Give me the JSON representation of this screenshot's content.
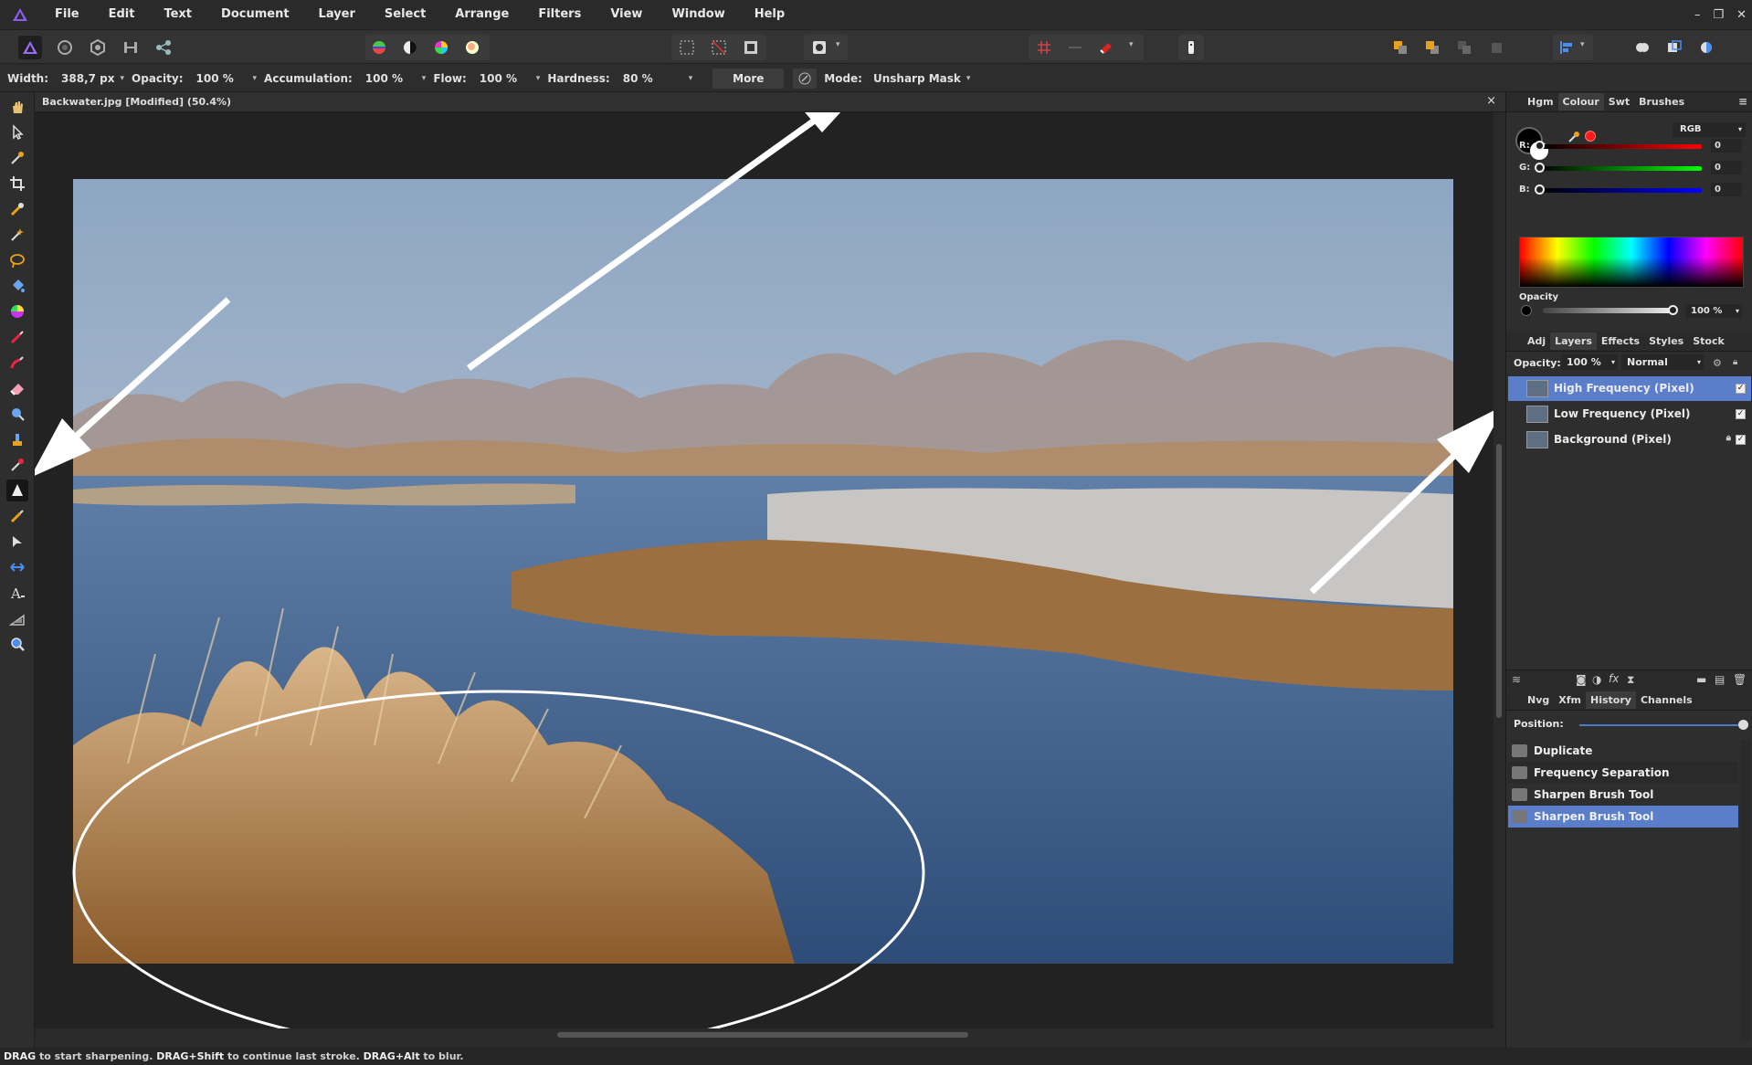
{
  "menubar": {
    "items": [
      "File",
      "Edit",
      "Text",
      "Document",
      "Layer",
      "Select",
      "Arrange",
      "Filters",
      "View",
      "Window",
      "Help"
    ],
    "window_controls": [
      "–",
      "❐",
      "✕"
    ]
  },
  "context": {
    "width_label": "Width:",
    "width_value": "388,7 px",
    "opacity_label": "Opacity:",
    "opacity_value": "100 %",
    "accumulation_label": "Accumulation:",
    "accumulation_value": "100 %",
    "flow_label": "Flow:",
    "flow_value": "100 %",
    "hardness_label": "Hardness:",
    "hardness_value": "80 %",
    "more_label": "More",
    "mode_label": "Mode:",
    "mode_value": "Unsharp Mask"
  },
  "document": {
    "title": "Backwater.jpg [Modified] (50.4%)",
    "close": "×"
  },
  "colour_panel": {
    "tabs": [
      "Hgm",
      "Colour",
      "Swt",
      "Brushes"
    ],
    "active_tab": "Colour",
    "model": "RGB",
    "r_label": "R:",
    "r_value": "0",
    "g_label": "G:",
    "g_value": "0",
    "b_label": "B:",
    "b_value": "0",
    "opacity_label": "Opacity",
    "opacity_value": "100 %",
    "primary_color": "#000000",
    "accent_red": "#ff1a1a"
  },
  "layers_panel": {
    "tabs": [
      "Adj",
      "Layers",
      "Effects",
      "Styles",
      "Stock"
    ],
    "active_tab": "Layers",
    "opacity_label": "Opacity:",
    "opacity_value": "100 %",
    "blend_mode": "Normal",
    "layers": [
      {
        "name": "High Frequency (Pixel)",
        "selected": true,
        "checked": "✓"
      },
      {
        "name": "Low Frequency (Pixel)",
        "selected": false,
        "checked": "✓"
      },
      {
        "name": "Background (Pixel)",
        "selected": false,
        "checked": "✓",
        "locked": true
      }
    ],
    "selection_color": "#5a7ec9"
  },
  "history_panel": {
    "tabs": [
      "Nvg",
      "Xfm",
      "History",
      "Channels"
    ],
    "active_tab": "History",
    "position_label": "Position:",
    "items": [
      {
        "name": "Duplicate",
        "selected": false
      },
      {
        "name": "Frequency Separation",
        "selected": false
      },
      {
        "name": "Sharpen Brush Tool",
        "selected": false
      },
      {
        "name": "Sharpen Brush Tool",
        "selected": true
      }
    ]
  },
  "status": {
    "k1": "DRAG",
    "t1": " to start sharpening. ",
    "k2": "DRAG+Shift",
    "t2": " to continue last stroke. ",
    "k3": "DRAG+Alt",
    "t3": " to blur."
  }
}
